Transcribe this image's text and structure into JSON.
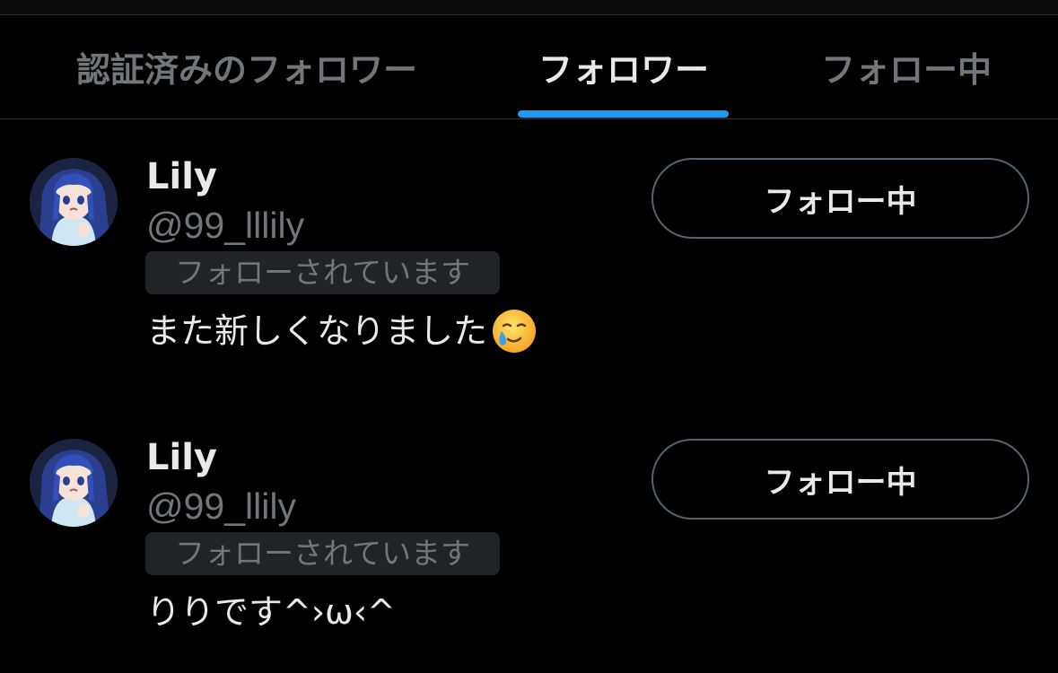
{
  "colors": {
    "background": "#000000",
    "accent": "#1d9bf0",
    "primary_text": "#e7e9ea",
    "secondary_text": "#71767b",
    "divider": "#2f3336",
    "badge_bg": "#202327"
  },
  "tabs": [
    {
      "label": "認証済みのフォロワー",
      "active": false
    },
    {
      "label": "フォロワー",
      "active": true
    },
    {
      "label": "フォロー中",
      "active": false
    }
  ],
  "users": [
    {
      "display_name": "Lily",
      "handle": "@99_lllily",
      "follows_you": "フォローされています",
      "bio": "また新しくなりました",
      "bio_emoji": "face-holding-back-tears-emoji",
      "button_label": "フォロー中"
    },
    {
      "display_name": "Lily",
      "handle": "@99_llily",
      "follows_you": "フォローされています",
      "bio": "りりです^›ω‹^",
      "button_label": "フォロー中"
    }
  ]
}
